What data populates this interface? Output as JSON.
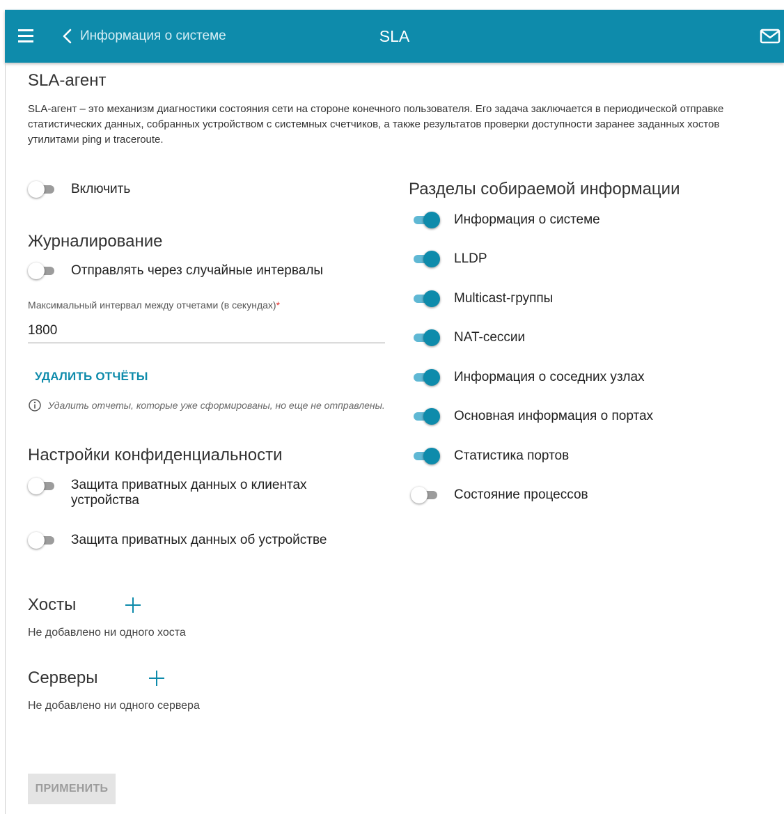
{
  "header": {
    "back_label": "Информация о системе",
    "title": "SLA",
    "icons": [
      "menu-icon",
      "chevron-left-icon",
      "mail-icon"
    ]
  },
  "agent": {
    "title": "SLA-агент",
    "description": "SLA-агент – это механизм диагностики состояния сети на стороне конечного пользователя. Его задача заключается в периодической отправке статистических данных, собранных устройством с системных счетчиков, а также результатов проверки доступности заранее заданных хостов утилитами ping и traceroute.",
    "enable": {
      "label": "Включить",
      "on": false
    }
  },
  "logging": {
    "title": "Журналирование",
    "random_intervals": {
      "label": "Отправлять через случайные интервалы",
      "on": false
    },
    "max_interval": {
      "label": "Максимальный интервал между отчетами (в секундах)",
      "required_mark": "*",
      "value": "1800"
    },
    "delete_reports": "УДАЛИТЬ ОТЧЁТЫ",
    "delete_hint": "Удалить отчеты, которые уже сформированы, но еще не отправлены."
  },
  "privacy": {
    "title": "Настройки конфиденциальности",
    "clients_protection": {
      "label": "Защита приватных данных о клиентах устройства",
      "on": false
    },
    "device_protection": {
      "label": "Защита приватных данных об устройстве",
      "on": false
    }
  },
  "sections": {
    "title": "Разделы собираемой информации",
    "items": [
      {
        "label": "Информация о системе",
        "on": true
      },
      {
        "label": "LLDP",
        "on": true
      },
      {
        "label": "Multicast-группы",
        "on": true
      },
      {
        "label": "NAT-сессии",
        "on": true
      },
      {
        "label": "Информация о соседних узлах",
        "on": true
      },
      {
        "label": "Основная информация о портах",
        "on": true
      },
      {
        "label": "Статистика портов",
        "on": true
      },
      {
        "label": "Состояние процессов",
        "on": false
      }
    ]
  },
  "hosts": {
    "title": "Хосты",
    "empty": "Не добавлено ни одного хоста"
  },
  "servers": {
    "title": "Серверы",
    "empty": "Не добавлено ни одного сервера"
  },
  "apply_label": "ПРИМЕНИТЬ",
  "colors": {
    "accent": "#0e8bab",
    "toggle_on_track": "#5fb8d4",
    "toggle_off_track": "#9c9c9c",
    "required": "#e2302d"
  }
}
